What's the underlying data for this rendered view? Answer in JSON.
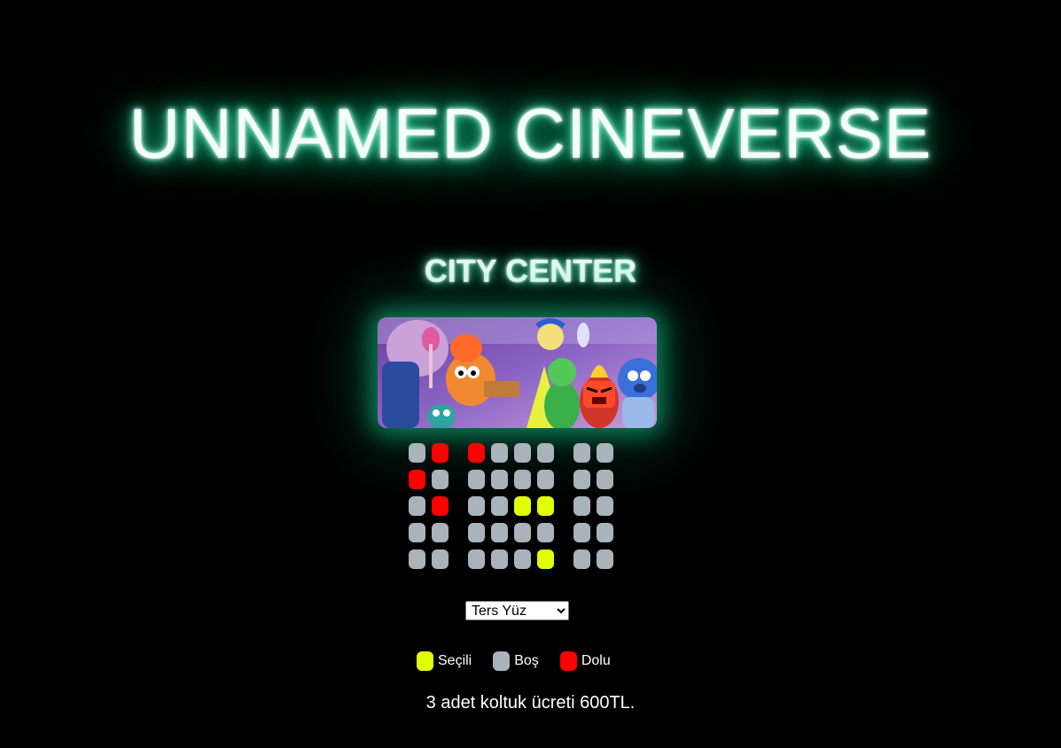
{
  "header": {
    "brand_title": "UNNAMED CINEVERSE",
    "cinema_name": "CITY CENTER"
  },
  "screen": {
    "image_name": "movie-poster-inside-out-2"
  },
  "seating": {
    "rows": [
      [
        "empty",
        "occupied",
        "occupied",
        "empty",
        "empty",
        "empty",
        "empty",
        "empty"
      ],
      [
        "occupied",
        "empty",
        "empty",
        "empty",
        "empty",
        "empty",
        "empty",
        "empty"
      ],
      [
        "empty",
        "occupied",
        "empty",
        "empty",
        "selected",
        "selected",
        "empty",
        "empty"
      ],
      [
        "empty",
        "empty",
        "empty",
        "empty",
        "empty",
        "empty",
        "empty",
        "empty"
      ],
      [
        "empty",
        "empty",
        "empty",
        "empty",
        "empty",
        "selected",
        "empty",
        "empty"
      ]
    ],
    "aisles_after_columns": [
      2,
      6
    ]
  },
  "movie_select": {
    "selected": "Ters Yüz"
  },
  "legend": {
    "selected_label": "Seçili",
    "empty_label": "Boş",
    "occupied_label": "Dolu"
  },
  "summary": {
    "text": "3 adet koltuk ücreti 600TL."
  },
  "colors": {
    "background": "#000000",
    "glow": "#1fd497",
    "seat_empty": "#aab2bb",
    "seat_occupied": "#ff0000",
    "seat_selected": "#e2ff00"
  }
}
